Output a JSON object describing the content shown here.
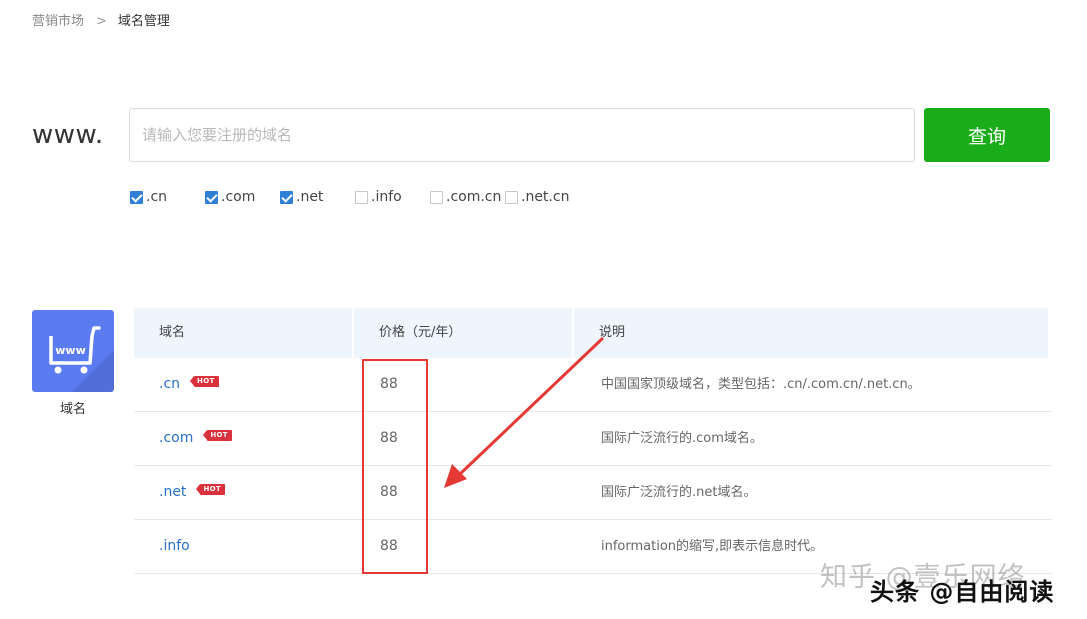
{
  "breadcrumb": {
    "parent": "营销市场",
    "separator": ">",
    "current": "域名管理"
  },
  "search": {
    "prefix": "www.",
    "placeholder": "请输入您要注册的域名",
    "value": "",
    "button_label": "查询"
  },
  "tlds": [
    {
      "label": ".cn",
      "checked": true
    },
    {
      "label": ".com",
      "checked": true
    },
    {
      "label": ".net",
      "checked": true
    },
    {
      "label": ".info",
      "checked": false
    },
    {
      "label": ".com.cn",
      "checked": false
    },
    {
      "label": ".net.cn",
      "checked": false
    }
  ],
  "tile": {
    "icon_text": "www",
    "label": "域名",
    "color": "#5b7cf0"
  },
  "table": {
    "headers": [
      "域名",
      "价格（元/年）",
      "说明"
    ],
    "rows": [
      {
        "name": ".cn",
        "hot": "HOT",
        "price": "88",
        "desc": "中国国家顶级域名，类型包括：.cn/.com.cn/.net.cn。"
      },
      {
        "name": ".com",
        "hot": "HOT",
        "price": "88",
        "desc": "国际广泛流行的.com域名。"
      },
      {
        "name": ".net",
        "hot": "HOT",
        "price": "88",
        "desc": "国际广泛流行的.net域名。"
      },
      {
        "name": ".info",
        "hot": "",
        "price": "88",
        "desc": "information的缩写,即表示信息时代。"
      }
    ]
  },
  "colors": {
    "accent_green": "#1aad19",
    "link_blue": "#2a6fc9",
    "hot_red": "#d9323c",
    "annotation_red": "#e53935"
  },
  "watermarks": {
    "zhihu": "知乎 @壹乐网络",
    "toutiao": "头条 @自由阅读"
  }
}
